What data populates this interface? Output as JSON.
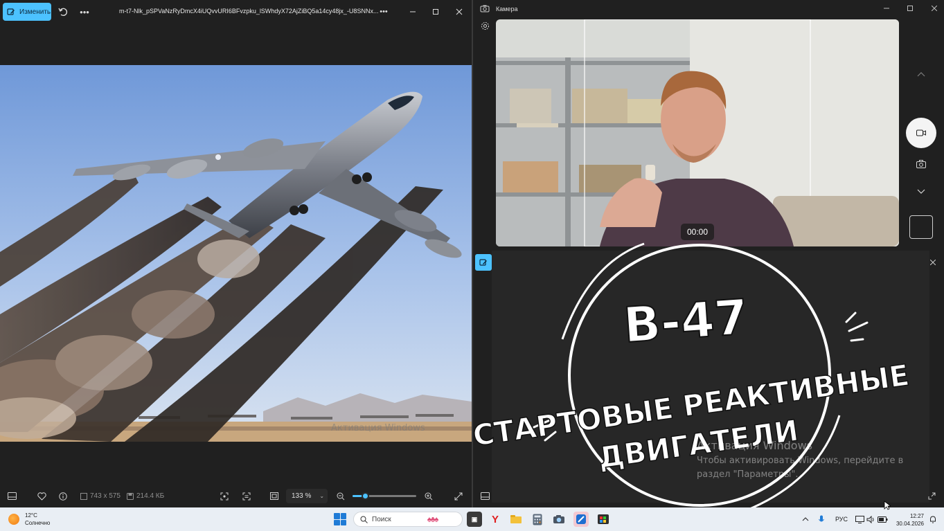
{
  "photos_window": {
    "edit_label": "Изменить",
    "file_title": "m-t7-Nlk_pSPVaNzRyDmcX4iUQvvURI6BFvzpku_lSWhdyX72AjZiBQ5a14cy48jx_-U8SNNx...",
    "image_dimensions": "743 x 575",
    "file_size": "214.4 КБ",
    "zoom_level": "133 %",
    "zoom_fraction": 0.2
  },
  "camera_window": {
    "title": "Камера",
    "timer": "00:00"
  },
  "overlay": {
    "title": "B-47",
    "subtitle_line1": "СТАРТОВЫЕ РЕАКТИВНЫЕ",
    "subtitle_line2": "ДВИГАТЕЛИ"
  },
  "watermark": {
    "small": "Активация Windows",
    "heading": "Активация Windows",
    "line1": "Чтобы активировать Windows, перейдите в",
    "line2": "раздел \"Параметры\"."
  },
  "taskbar": {
    "temperature": "12°C",
    "weather_state": "Солнечно",
    "search_placeholder": "Поиск",
    "language": "РУС",
    "time": "12:27",
    "date": "30.04.2026"
  },
  "colors": {
    "accent": "#4cc2ff",
    "window_bg": "#202020",
    "taskbar_bg": "#e9eef4"
  }
}
